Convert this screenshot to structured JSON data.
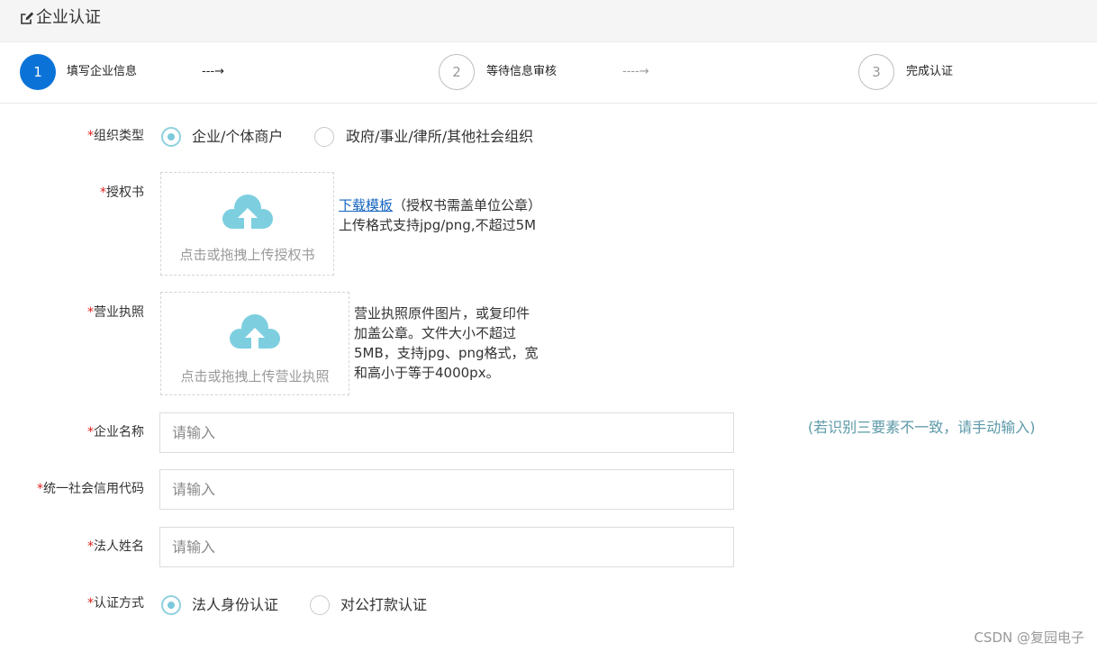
{
  "header": {
    "title": "企业认证"
  },
  "steps": [
    {
      "num": "1",
      "label": "填写企业信息"
    },
    {
      "num": "2",
      "label": "等待信息审核"
    },
    {
      "num": "3",
      "label": "完成认证"
    }
  ],
  "step_arrow_1": "---→",
  "step_arrow_2": "----→",
  "required_mark": "*",
  "org_type": {
    "label": "组织类型",
    "options": [
      "企业/个体商户",
      "政府/事业/律所/其他社会组织"
    ],
    "selected": 0
  },
  "authorization": {
    "label": "授权书",
    "upload_text": "点击或拖拽上传授权书",
    "download_link": "下载模板",
    "note1": "（授权书需盖单位公章）",
    "note2": "上传格式支持jpg/png,不超过5M"
  },
  "license": {
    "label": "营业执照",
    "upload_text": "点击或拖拽上传营业执照",
    "note": [
      "营业执照原件图片，或复印件",
      "加盖公章。文件大小不超过",
      "5MB，支持jpg、png格式，宽",
      "和高小于等于4000px。"
    ]
  },
  "company_name": {
    "label": "企业名称",
    "placeholder": "请输入"
  },
  "credit_code": {
    "label": "统一社会信用代码",
    "placeholder": "请输入"
  },
  "legal_name": {
    "label": "法人姓名",
    "placeholder": "请输入"
  },
  "hint": "(若识别三要素不一致，请手动输入)",
  "auth_method": {
    "label": "认证方式",
    "options": [
      "法人身份认证",
      "对公打款认证"
    ],
    "selected": 0
  },
  "watermark": "CSDN @复园电子",
  "colors": {
    "primary": "#0b73d7",
    "radio": "#7cc9da",
    "upload_icon": "#7dcfe0",
    "required": "#e0201a",
    "hint": "#5c9aa8",
    "link": "#1565c0"
  },
  "icons": {
    "header": "edit-icon",
    "upload": "cloud-upload-icon"
  }
}
